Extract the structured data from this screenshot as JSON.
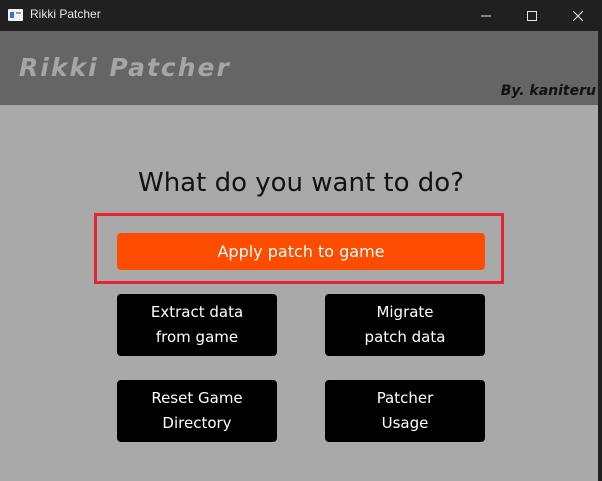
{
  "window": {
    "title": "Rikki Patcher",
    "controls": {
      "minimize": "—",
      "maximize": "☐",
      "close": "✕"
    }
  },
  "header": {
    "app_name": "Rikki Patcher",
    "author": "By. kaniteru"
  },
  "main": {
    "question": "What do you want to do?",
    "apply_button": "Apply patch to game",
    "extract_button": {
      "line1": "Extract data",
      "line2": "from game"
    },
    "migrate_button": {
      "line1": "Migrate",
      "line2": "patch data"
    },
    "reset_button": {
      "line1": "Reset Game",
      "line2": "Directory"
    },
    "usage_button": {
      "line1": "Patcher",
      "line2": "Usage"
    }
  },
  "colors": {
    "header_bg": "#656565",
    "main_bg": "#a9a9a9",
    "apply_accent": "#ff4d00",
    "highlight": "#e62532",
    "titlebar_bg": "#202020"
  }
}
